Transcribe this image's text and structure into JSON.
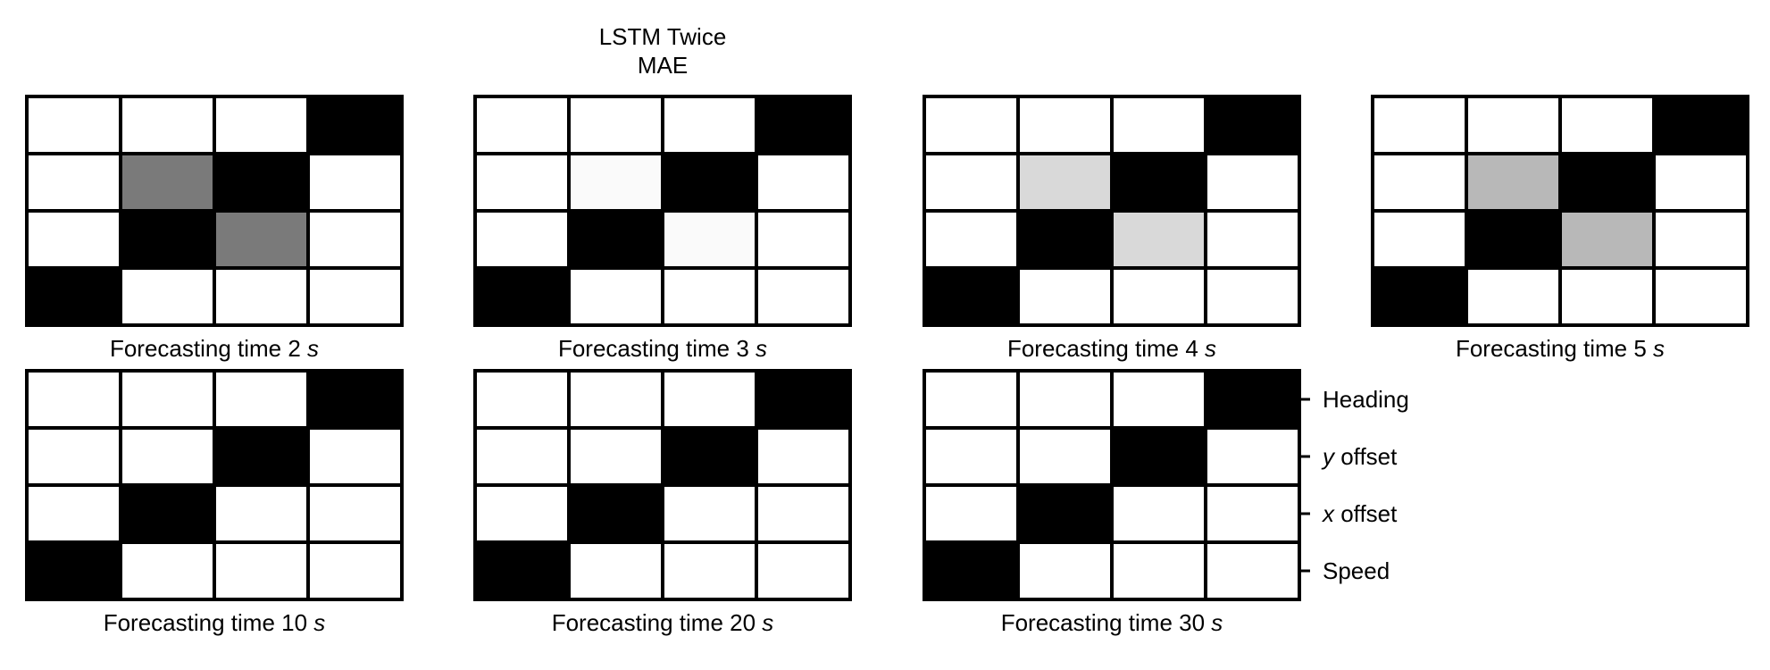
{
  "chart_data": {
    "type": "heatmap",
    "title_lines": [
      "LSTM Twice",
      "MAE"
    ],
    "colormap": "grayscale: 0 = white, 1 = black",
    "rows": [
      "Heading",
      "y offset",
      "x offset",
      "Speed"
    ],
    "row_tick_parts": [
      {
        "var": "",
        "rest": "Heading"
      },
      {
        "var": "y",
        "rest": " offset"
      },
      {
        "var": "x",
        "rest": " offset"
      },
      {
        "var": "",
        "rest": "Speed"
      }
    ],
    "n_cols": 4,
    "panels": [
      {
        "label_prefix": "Forecasting time 2 ",
        "unit": "s",
        "values": [
          [
            0,
            0,
            0,
            1
          ],
          [
            0,
            0.52,
            1,
            0
          ],
          [
            0,
            1,
            0.52,
            0
          ],
          [
            1,
            0,
            0,
            0
          ]
        ]
      },
      {
        "label_prefix": "Forecasting time 3 ",
        "unit": "s",
        "values": [
          [
            0,
            0,
            0,
            1
          ],
          [
            0,
            0.02,
            1,
            0
          ],
          [
            0,
            1,
            0.02,
            0
          ],
          [
            1,
            0,
            0,
            0
          ]
        ]
      },
      {
        "label_prefix": "Forecasting time 4 ",
        "unit": "s",
        "values": [
          [
            0,
            0,
            0,
            1
          ],
          [
            0,
            0.15,
            1,
            0
          ],
          [
            0,
            1,
            0.15,
            0
          ],
          [
            1,
            0,
            0,
            0
          ]
        ]
      },
      {
        "label_prefix": "Forecasting time 5 ",
        "unit": "s",
        "values": [
          [
            0,
            0,
            0,
            1
          ],
          [
            0,
            0.28,
            1,
            0
          ],
          [
            0,
            1,
            0.28,
            0
          ],
          [
            1,
            0,
            0,
            0
          ]
        ]
      },
      {
        "label_prefix": "Forecasting time 10 ",
        "unit": "s",
        "values": [
          [
            0,
            0,
            0,
            1
          ],
          [
            0,
            0,
            1,
            0
          ],
          [
            0,
            1,
            0,
            0
          ],
          [
            1,
            0,
            0,
            0
          ]
        ]
      },
      {
        "label_prefix": "Forecasting time 20 ",
        "unit": "s",
        "values": [
          [
            0,
            0,
            0,
            1
          ],
          [
            0,
            0,
            1,
            0
          ],
          [
            0,
            1,
            0,
            0
          ],
          [
            1,
            0,
            0,
            0
          ]
        ]
      },
      {
        "label_prefix": "Forecasting time 30 ",
        "unit": "s",
        "values": [
          [
            0,
            0,
            0,
            1
          ],
          [
            0,
            0,
            1,
            0
          ],
          [
            0,
            1,
            0,
            0
          ],
          [
            1,
            0,
            0,
            0
          ]
        ]
      }
    ]
  }
}
